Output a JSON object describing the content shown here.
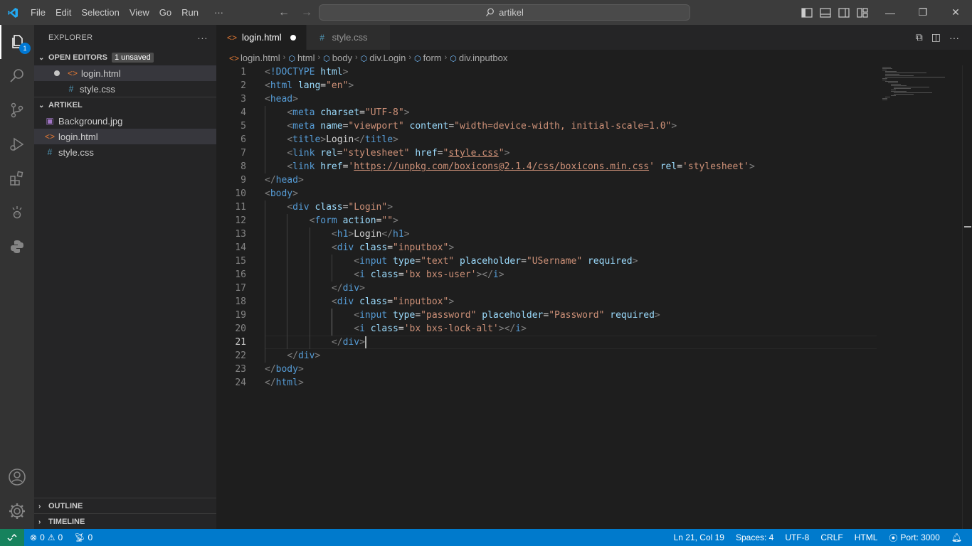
{
  "titlebar": {
    "menu": [
      "File",
      "Edit",
      "Selection",
      "View",
      "Go",
      "Run"
    ],
    "overflow": "···",
    "search": "artikel"
  },
  "activity": {
    "explorer_badge": "1"
  },
  "sidebar": {
    "title": "EXPLORER",
    "more": "···",
    "open_editors": {
      "label": "OPEN EDITORS",
      "badge": "1 unsaved",
      "files": [
        "login.html",
        "style.css"
      ]
    },
    "project": {
      "label": "ARTIKEL",
      "files": [
        "Background.jpg",
        "login.html",
        "style.css"
      ]
    },
    "outline": "OUTLINE",
    "timeline": "TIMELINE"
  },
  "tabs": [
    {
      "label": "login.html",
      "icon": "html-file-icon",
      "active": true,
      "modified": true
    },
    {
      "label": "style.css",
      "icon": "css-file-icon",
      "active": false
    }
  ],
  "breadcrumb": [
    "login.html",
    "html",
    "body",
    "div.Login",
    "form",
    "div.inputbox"
  ],
  "code": {
    "current_line": 21,
    "lines": [
      [
        [
          "br",
          "<"
        ],
        [
          "tg",
          "!DOCTYPE "
        ],
        [
          "at",
          "html"
        ],
        [
          "br",
          ">"
        ]
      ],
      [
        [
          "br",
          "<"
        ],
        [
          "tg",
          "html "
        ],
        [
          "at",
          "lang"
        ],
        [
          "tx",
          "="
        ],
        [
          "st",
          "\"en\""
        ],
        [
          "br",
          ">"
        ]
      ],
      [
        [
          "br",
          "<"
        ],
        [
          "tg",
          "head"
        ],
        [
          "br",
          ">"
        ]
      ],
      [
        [
          "tx",
          "    "
        ],
        [
          "br",
          "<"
        ],
        [
          "tg",
          "meta "
        ],
        [
          "at",
          "charset"
        ],
        [
          "tx",
          "="
        ],
        [
          "st",
          "\"UTF-8\""
        ],
        [
          "br",
          ">"
        ]
      ],
      [
        [
          "tx",
          "    "
        ],
        [
          "br",
          "<"
        ],
        [
          "tg",
          "meta "
        ],
        [
          "at",
          "name"
        ],
        [
          "tx",
          "="
        ],
        [
          "st",
          "\"viewport\" "
        ],
        [
          "at",
          "content"
        ],
        [
          "tx",
          "="
        ],
        [
          "st",
          "\"width=device-width, initial-scale=1.0\""
        ],
        [
          "br",
          ">"
        ]
      ],
      [
        [
          "tx",
          "    "
        ],
        [
          "br",
          "<"
        ],
        [
          "tg",
          "title"
        ],
        [
          "br",
          ">"
        ],
        [
          "tx",
          "Login"
        ],
        [
          "br",
          "</"
        ],
        [
          "tg",
          "title"
        ],
        [
          "br",
          ">"
        ]
      ],
      [
        [
          "tx",
          "    "
        ],
        [
          "br",
          "<"
        ],
        [
          "tg",
          "link "
        ],
        [
          "at",
          "rel"
        ],
        [
          "tx",
          "="
        ],
        [
          "st",
          "\"stylesheet\" "
        ],
        [
          "at",
          "href"
        ],
        [
          "tx",
          "="
        ],
        [
          "st",
          "\""
        ],
        [
          "stu",
          "style.css"
        ],
        [
          "st",
          "\""
        ],
        [
          "br",
          ">"
        ]
      ],
      [
        [
          "tx",
          "    "
        ],
        [
          "br",
          "<"
        ],
        [
          "tg",
          "link "
        ],
        [
          "at",
          "href"
        ],
        [
          "tx",
          "="
        ],
        [
          "st",
          "'"
        ],
        [
          "stu",
          "https://unpkg.com/boxicons@2.1.4/css/boxicons.min.css"
        ],
        [
          "st",
          "' "
        ],
        [
          "at",
          "rel"
        ],
        [
          "tx",
          "="
        ],
        [
          "st",
          "'stylesheet'"
        ],
        [
          "br",
          ">"
        ]
      ],
      [
        [
          "br",
          "</"
        ],
        [
          "tg",
          "head"
        ],
        [
          "br",
          ">"
        ]
      ],
      [
        [
          "br",
          "<"
        ],
        [
          "tg",
          "body"
        ],
        [
          "br",
          ">"
        ]
      ],
      [
        [
          "tx",
          "    "
        ],
        [
          "br",
          "<"
        ],
        [
          "tg",
          "div "
        ],
        [
          "at",
          "class"
        ],
        [
          "tx",
          "="
        ],
        [
          "st",
          "\"Login\""
        ],
        [
          "br",
          ">"
        ]
      ],
      [
        [
          "tx",
          "        "
        ],
        [
          "br",
          "<"
        ],
        [
          "tg",
          "form "
        ],
        [
          "at",
          "action"
        ],
        [
          "tx",
          "="
        ],
        [
          "st",
          "\"\""
        ],
        [
          "br",
          ">"
        ]
      ],
      [
        [
          "tx",
          "            "
        ],
        [
          "br",
          "<"
        ],
        [
          "tg",
          "h1"
        ],
        [
          "br",
          ">"
        ],
        [
          "tx",
          "Login"
        ],
        [
          "br",
          "</"
        ],
        [
          "tg",
          "h1"
        ],
        [
          "br",
          ">"
        ]
      ],
      [
        [
          "tx",
          "            "
        ],
        [
          "br",
          "<"
        ],
        [
          "tg",
          "div "
        ],
        [
          "at",
          "class"
        ],
        [
          "tx",
          "="
        ],
        [
          "st",
          "\"inputbox\""
        ],
        [
          "br",
          ">"
        ]
      ],
      [
        [
          "tx",
          "                "
        ],
        [
          "br",
          "<"
        ],
        [
          "tg",
          "input "
        ],
        [
          "at",
          "type"
        ],
        [
          "tx",
          "="
        ],
        [
          "st",
          "\"text\" "
        ],
        [
          "at",
          "placeholder"
        ],
        [
          "tx",
          "="
        ],
        [
          "st",
          "\"USername\" "
        ],
        [
          "at",
          "required"
        ],
        [
          "br",
          ">"
        ]
      ],
      [
        [
          "tx",
          "                "
        ],
        [
          "br",
          "<"
        ],
        [
          "tg",
          "i "
        ],
        [
          "at",
          "class"
        ],
        [
          "tx",
          "="
        ],
        [
          "st",
          "'bx bxs-user'"
        ],
        [
          "br",
          "></"
        ],
        [
          "tg",
          "i"
        ],
        [
          "br",
          ">"
        ]
      ],
      [
        [
          "tx",
          "            "
        ],
        [
          "br",
          "</"
        ],
        [
          "tg",
          "div"
        ],
        [
          "br",
          ">"
        ]
      ],
      [
        [
          "tx",
          "            "
        ],
        [
          "br",
          "<"
        ],
        [
          "tg",
          "div "
        ],
        [
          "at",
          "class"
        ],
        [
          "tx",
          "="
        ],
        [
          "st",
          "\"inputbox\""
        ],
        [
          "br",
          ">"
        ]
      ],
      [
        [
          "tx",
          "                "
        ],
        [
          "br",
          "<"
        ],
        [
          "tg",
          "input "
        ],
        [
          "at",
          "type"
        ],
        [
          "tx",
          "="
        ],
        [
          "st",
          "\"password\" "
        ],
        [
          "at",
          "placeholder"
        ],
        [
          "tx",
          "="
        ],
        [
          "st",
          "\"Password\" "
        ],
        [
          "at",
          "required"
        ],
        [
          "br",
          ">"
        ]
      ],
      [
        [
          "tx",
          "                "
        ],
        [
          "br",
          "<"
        ],
        [
          "tg",
          "i "
        ],
        [
          "at",
          "class"
        ],
        [
          "tx",
          "="
        ],
        [
          "st",
          "'bx bxs-lock-alt'"
        ],
        [
          "br",
          "></"
        ],
        [
          "tg",
          "i"
        ],
        [
          "br",
          ">"
        ]
      ],
      [
        [
          "tx",
          "            "
        ],
        [
          "br",
          "</"
        ],
        [
          "tg",
          "div"
        ],
        [
          "br",
          ">"
        ]
      ],
      [
        [
          "tx",
          "    "
        ],
        [
          "br",
          "</"
        ],
        [
          "tg",
          "div"
        ],
        [
          "br",
          ">"
        ]
      ],
      [
        [
          "br",
          "</"
        ],
        [
          "tg",
          "body"
        ],
        [
          "br",
          ">"
        ]
      ],
      [
        [
          "br",
          "</"
        ],
        [
          "tg",
          "html"
        ],
        [
          "br",
          ">"
        ]
      ]
    ]
  },
  "status": {
    "errors": "0",
    "warnings": "0",
    "ports_count": "0",
    "position": "Ln 21, Col 19",
    "spaces": "Spaces: 4",
    "encoding": "UTF-8",
    "eol": "CRLF",
    "language": "HTML",
    "port": "Port: 3000"
  },
  "colors": {
    "statusbar": "#007acc",
    "remote": "#16825d",
    "accent": "#0078d4"
  }
}
